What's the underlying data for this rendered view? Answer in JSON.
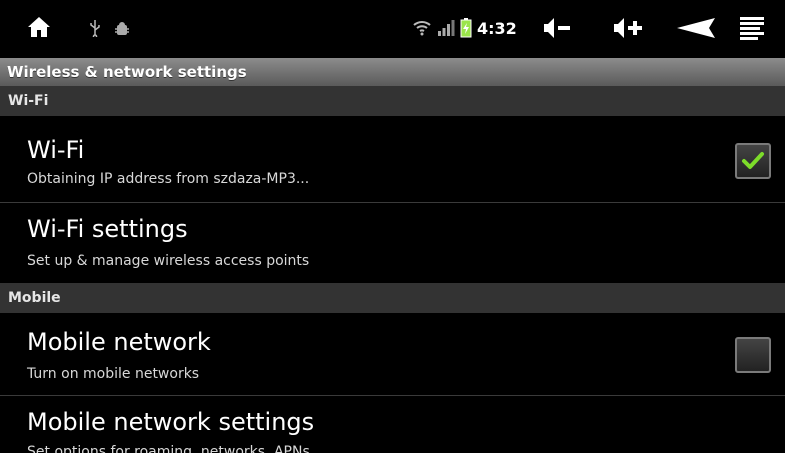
{
  "status_bar": {
    "time": "4:32",
    "icons": [
      "home-icon",
      "usb-icon",
      "debug-icon",
      "wifi-icon",
      "signal-icon",
      "battery-icon",
      "volume-down-icon",
      "volume-up-icon",
      "back-icon",
      "menu-icon"
    ],
    "battery_color": "#9be54a"
  },
  "header": {
    "title": "Wireless & network settings"
  },
  "sections": {
    "wifi": {
      "label": "Wi-Fi"
    },
    "mobile": {
      "label": "Mobile"
    }
  },
  "items": {
    "wifi": {
      "title": "Wi-Fi",
      "summary": "Obtaining IP address from szdaza-MP3...",
      "checked": true
    },
    "wifi_settings": {
      "title": "Wi-Fi settings",
      "summary": "Set up & manage wireless access points"
    },
    "mobile_network": {
      "title": "Mobile network",
      "summary": "Turn on mobile networks",
      "checked": false
    },
    "mobile_settings": {
      "title": "Mobile network settings",
      "summary": "Set options for roaming, networks, APNs"
    }
  },
  "colors": {
    "check": "#7ddc2a",
    "section_bg": "#333333",
    "title_bar": "#7a7a7a"
  }
}
